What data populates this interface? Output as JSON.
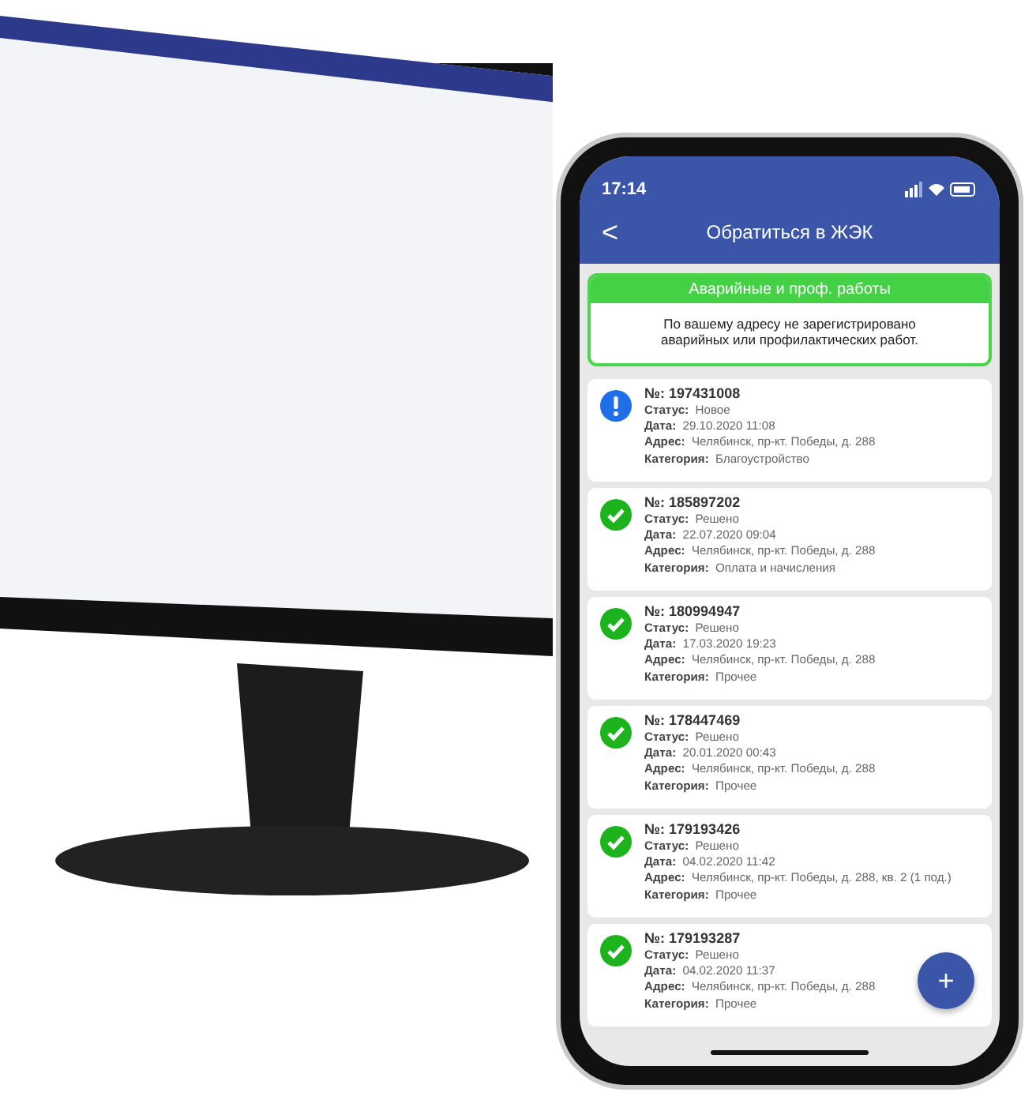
{
  "status_bar": {
    "time": "17:14"
  },
  "header": {
    "back": "<",
    "title": "Обратиться в ЖЭК"
  },
  "notice": {
    "title": "Аварийные и проф. работы",
    "text": "По вашему адресу не зарегистрировано аварийных или профилактических работ."
  },
  "requests": [
    {
      "kind": "new",
      "number_label": "№:",
      "number": "197431008",
      "fields": [
        {
          "label": "Статус:",
          "value": "Новое"
        },
        {
          "label": "Дата:",
          "value": "29.10.2020 11:08"
        },
        {
          "label": "Адрес:",
          "value": "Челябинск, пр-кт. Победы, д. 288"
        },
        {
          "label": "Категория:",
          "value": "Благоустройство"
        }
      ]
    },
    {
      "kind": "resolved",
      "number_label": "№:",
      "number": "185897202",
      "fields": [
        {
          "label": "Статус:",
          "value": "Решено"
        },
        {
          "label": "Дата:",
          "value": "22.07.2020 09:04"
        },
        {
          "label": "Адрес:",
          "value": "Челябинск, пр-кт. Победы, д. 288"
        },
        {
          "label": "Категория:",
          "value": "Оплата и начисления"
        }
      ]
    },
    {
      "kind": "resolved",
      "number_label": "№:",
      "number": "180994947",
      "fields": [
        {
          "label": "Статус:",
          "value": "Решено"
        },
        {
          "label": "Дата:",
          "value": "17.03.2020 19:23"
        },
        {
          "label": "Адрес:",
          "value": "Челябинск, пр-кт. Победы, д. 288"
        },
        {
          "label": "Категория:",
          "value": "Прочее"
        }
      ]
    },
    {
      "kind": "resolved",
      "number_label": "№:",
      "number": "178447469",
      "fields": [
        {
          "label": "Статус:",
          "value": "Решено"
        },
        {
          "label": "Дата:",
          "value": "20.01.2020 00:43"
        },
        {
          "label": "Адрес:",
          "value": "Челябинск, пр-кт. Победы, д. 288"
        },
        {
          "label": "Категория:",
          "value": "Прочее"
        }
      ]
    },
    {
      "kind": "resolved",
      "number_label": "№:",
      "number": "179193426",
      "fields": [
        {
          "label": "Статус:",
          "value": "Решено"
        },
        {
          "label": "Дата:",
          "value": "04.02.2020 11:42"
        },
        {
          "label": "Адрес:",
          "value": "Челябинск, пр-кт. Победы, д. 288, кв. 2 (1 под.)"
        },
        {
          "label": "Категория:",
          "value": "Прочее"
        }
      ]
    },
    {
      "kind": "resolved",
      "number_label": "№:",
      "number": "179193287",
      "fields": [
        {
          "label": "Статус:",
          "value": "Решено"
        },
        {
          "label": "Дата:",
          "value": "04.02.2020 11:37"
        },
        {
          "label": "Адрес:",
          "value": "Челябинск, пр-кт. Победы, д. 288"
        },
        {
          "label": "Категория:",
          "value": "Прочее"
        }
      ]
    }
  ],
  "fab": "+"
}
